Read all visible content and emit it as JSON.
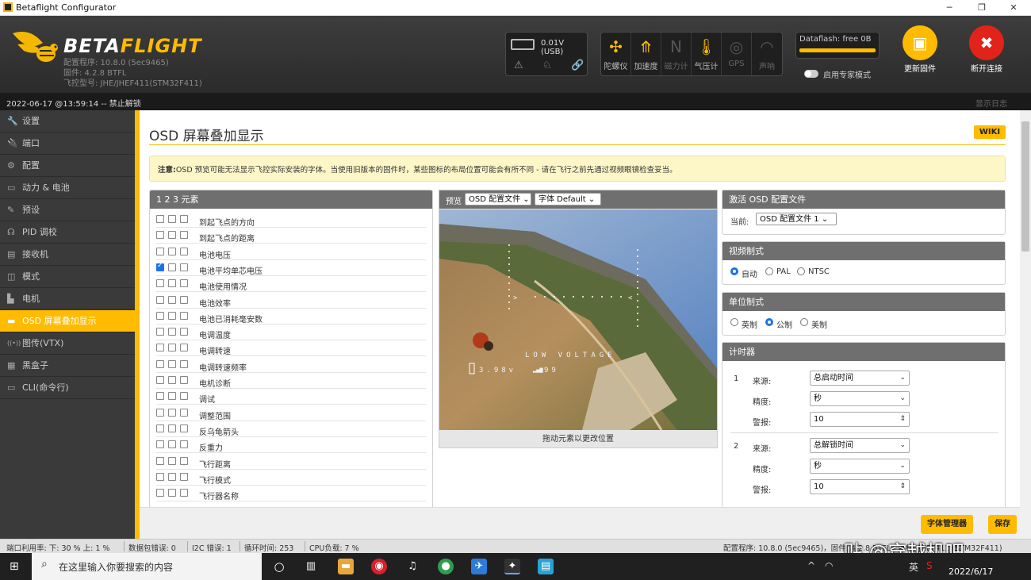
{
  "window": {
    "title": "Betaflight Configurator",
    "minimize": "─",
    "maximize": "❐",
    "close": "✕"
  },
  "header": {
    "logo_main": "BETA",
    "logo_accent": "FLIGHT",
    "version_lines": [
      "配置程序: 10.8.0 (5ec9465)",
      "固件: 4.2.8 BTFL",
      "飞控型号: JHE/JHEF411(STM32F411)"
    ],
    "voltage": "0.01V (USB)",
    "sensors": [
      {
        "label": "陀螺仪",
        "glyph": "✣",
        "active": true
      },
      {
        "label": "加速度",
        "glyph": "⤊",
        "active": true
      },
      {
        "label": "磁力计",
        "glyph": "N",
        "active": false
      },
      {
        "label": "气压计",
        "glyph": "🌡",
        "active": true
      },
      {
        "label": "GPS",
        "glyph": "◎",
        "active": false
      },
      {
        "label": "声呐",
        "glyph": "◠",
        "active": false
      }
    ],
    "dataflash": "Dataflash: free 0B",
    "expert_mode": "启用专家模式",
    "update_firmware": "更新固件",
    "disconnect": "断开连接",
    "colors": {
      "accent": "#ffbb00",
      "disconnect": "#e2231a"
    }
  },
  "strip": {
    "left": "2022-06-17 @13:59:14 -- 禁止解锁",
    "right": "显示日志"
  },
  "sidebar": {
    "items": [
      {
        "label": "设置",
        "icon": "🔧"
      },
      {
        "label": "端口",
        "icon": "🔌"
      },
      {
        "label": "配置",
        "icon": "⚙"
      },
      {
        "label": "动力 & 电池",
        "icon": "▭"
      },
      {
        "label": "预设",
        "icon": "✎"
      },
      {
        "label": "PID 调校",
        "icon": "☊"
      },
      {
        "label": "接收机",
        "icon": "▤"
      },
      {
        "label": "模式",
        "icon": "◫"
      },
      {
        "label": "电机",
        "icon": "▙"
      },
      {
        "label": "OSD 屏幕叠加显示",
        "icon": "▬",
        "active": true
      },
      {
        "label": "图传(VTX)",
        "icon": "((•))"
      },
      {
        "label": "黑盒子",
        "icon": "▦"
      },
      {
        "label": "CLI(命令行)",
        "icon": "▭"
      }
    ]
  },
  "page": {
    "title": "OSD 屏幕叠加显示",
    "wiki": "WIKI",
    "note_bold": "注意:",
    "note": "OSD 预览可能无法显示飞控实际安装的字体。当使用旧版本的固件时，某些图标的布局位置可能会有所不同 - 请在飞行之前先通过视频眼镜检查妥当。"
  },
  "elements": {
    "header": "1   2   3   元素",
    "rows": [
      {
        "label": "到起飞点的方向",
        "c1": false
      },
      {
        "label": "到起飞点的距离",
        "c1": false
      },
      {
        "label": "电池电压",
        "c1": false
      },
      {
        "label": "电池平均单芯电压",
        "c1": true
      },
      {
        "label": "电池使用情况",
        "c1": false
      },
      {
        "label": "电池效率",
        "c1": false
      },
      {
        "label": "电池已消耗毫安数",
        "c1": false
      },
      {
        "label": "电调温度",
        "c1": false
      },
      {
        "label": "电调转速",
        "c1": false
      },
      {
        "label": "电调转速频率",
        "c1": false
      },
      {
        "label": "电机诊断",
        "c1": false
      },
      {
        "label": "调试",
        "c1": false
      },
      {
        "label": "调整范围",
        "c1": false
      },
      {
        "label": "反乌龟箭头",
        "c1": false
      },
      {
        "label": "反重力",
        "c1": false
      },
      {
        "label": "飞行距离",
        "c1": false
      },
      {
        "label": "飞行模式",
        "c1": false
      },
      {
        "label": "飞行器名称",
        "c1": false
      }
    ]
  },
  "preview": {
    "label": "预览",
    "profile_select": "OSD 配置文件",
    "font_select": "字体 Default",
    "osd_warning": "LOW VOLTAGE",
    "osd_voltage": "3.98v",
    "osd_rssi": "99",
    "footer": "拖动元素以更改位置"
  },
  "active_profile": {
    "header": "激活 OSD 配置文件",
    "current_label": "当前:",
    "current_value": "OSD 配置文件 1"
  },
  "video_format": {
    "header": "视频制式",
    "options": [
      "自动",
      "PAL",
      "NTSC"
    ],
    "selected": 0
  },
  "units": {
    "header": "单位制式",
    "options": [
      "英制",
      "公制",
      "美制"
    ],
    "selected": 1
  },
  "timers": {
    "header": "计时器",
    "source_label": "来源:",
    "precision_label": "精度:",
    "alarm_label": "警报:",
    "items": [
      {
        "num": "1",
        "source": "总启动时间",
        "precision": "秒",
        "alarm": "10"
      },
      {
        "num": "2",
        "source": "总解锁时间",
        "precision": "秒",
        "alarm": "10"
      }
    ]
  },
  "buttons": {
    "font_manager": "字体管理器",
    "save": "保存"
  },
  "statusbar": {
    "port_util": "端口利用率: 下: 30 % 上: 1 %",
    "packet_error": "数据包错误: 0",
    "i2c_error": "I2C 错误: 1",
    "cycle_time": "循环时间: 253",
    "cpu_load": "CPU负载: 7 %",
    "right": "配置程序: 10.8.0 (5ec9465)，固件: 4.2.8 BTFL，目标: JHEF411 (STM32F411)"
  },
  "taskbar": {
    "search_placeholder": "在这里输入你要搜索的内容",
    "date": "2022/6/17",
    "ime": "英"
  },
  "watermark": "贴 @穿越机吧"
}
